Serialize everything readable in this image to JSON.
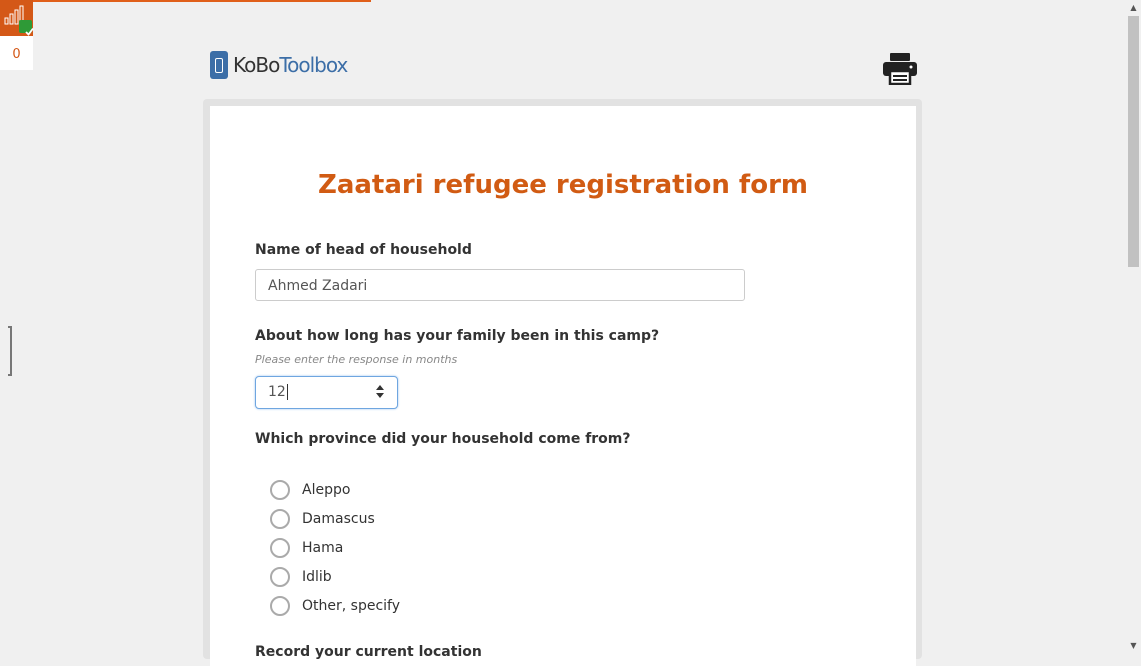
{
  "status": {
    "count": "0"
  },
  "logo": {
    "part1": "KoBo",
    "part2": "Toolbox"
  },
  "form": {
    "title": "Zaatari refugee registration form",
    "q1": {
      "label": "Name of head of household",
      "value": "Ahmed Zadari"
    },
    "q2": {
      "label": "About how long has your family been in this camp?",
      "hint": "Please enter the response in months",
      "value": "12"
    },
    "q3": {
      "label": "Which province did your household come from?",
      "options": [
        "Aleppo",
        "Damascus",
        "Hama",
        "Idlib",
        "Other, specify"
      ]
    },
    "q4": {
      "label": "Record your current location"
    }
  }
}
